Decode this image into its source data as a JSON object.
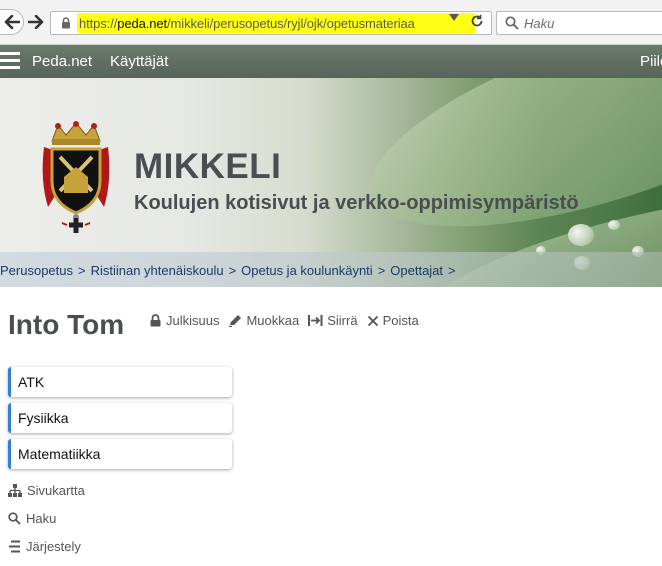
{
  "browser": {
    "url_scheme": "https://",
    "url_host": "peda.net",
    "url_path": "/mikkeli/perusopetus/ryjl/ojk/opetusmateriaa",
    "search_placeholder": "Haku",
    "highlight_color": "#ffff14"
  },
  "site_nav": {
    "brand": "Peda.net",
    "users": "Käyttäjät",
    "right_cut": "Piilo"
  },
  "banner": {
    "title": "MIKKELI",
    "subtitle": "Koulujen kotisivut ja verkko-oppimisympäristö"
  },
  "breadcrumb": {
    "items": [
      "Perusopetus",
      "Ristiinan yhtenäiskoulu",
      "Opetus ja koulunkäynti",
      "Opettajat"
    ],
    "separator": ">"
  },
  "page": {
    "title": "Into Tom",
    "actions": {
      "publicity": "Julkisuus",
      "edit": "Muokkaa",
      "move": "Siirrä",
      "delete": "Poista"
    },
    "items": [
      "ATK",
      "Fysiikka",
      "Matematiikka"
    ],
    "links": {
      "sitemap": "Sivukartta",
      "search": "Haku",
      "arrange": "Järjestely"
    }
  },
  "colors": {
    "accent": "#2f7fd6",
    "nav_bar": "#5f6d60",
    "title_text": "#4a4e52",
    "crumb_text": "#1d3a63"
  }
}
